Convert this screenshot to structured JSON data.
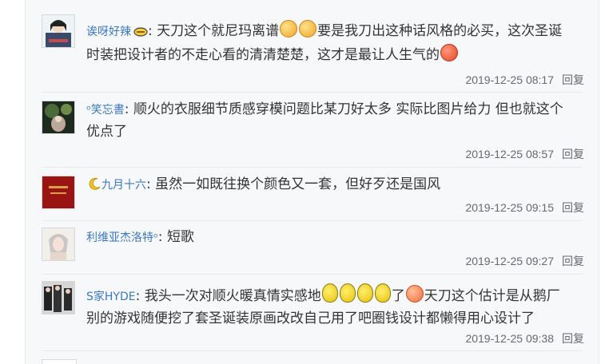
{
  "comments": [
    {
      "username": "诶呀好辣",
      "colon": ":",
      "text_part1": "天刀这个就尼玛离谱",
      "text_part2": "要是我刀出这种话风格的必买，这次圣诞",
      "text_line2": "时装把设计者的不走心看的清清楚楚，这才是最让人生气的",
      "timestamp": "2019-12-25 08:17",
      "reply_label": "回复"
    },
    {
      "username": "ᵒ笑忘書",
      "colon": ":",
      "text_line1": "顺火的衣服细节质感穿模问题比某刀好太多 实际比图片给力 但也就这个",
      "text_line2": "优点了",
      "timestamp": "2019-12-25 08:57",
      "reply_label": "回复"
    },
    {
      "username": "九月十六",
      "colon": ":",
      "text_line1": "虽然一如既往换个颜色又一套，但好歹还是国风",
      "timestamp": "2019-12-25 09:15",
      "reply_label": "回复"
    },
    {
      "username": "利维亚杰洛特ᵒ",
      "colon": ":",
      "text_line1": "短歌",
      "timestamp": "2019-12-25 09:27",
      "reply_label": "回复"
    },
    {
      "username": "S家HYDE",
      "colon": ":",
      "text_part1": "我头一次对顺火暖真情实感地",
      "text_part2": "了",
      "text_part3": "天刀这个估计是从鹅厂",
      "text_line2": "别的游戏随便挖了套圣诞装原画改改自己用了吧圈钱设计都懒得用心设计了",
      "timestamp": "2019-12-25 09:38",
      "reply_label": "回复"
    }
  ],
  "colors": {
    "username": "#3b78b8",
    "text": "#333333",
    "meta": "#666a70",
    "panel_bg": "#f7f8fa"
  }
}
